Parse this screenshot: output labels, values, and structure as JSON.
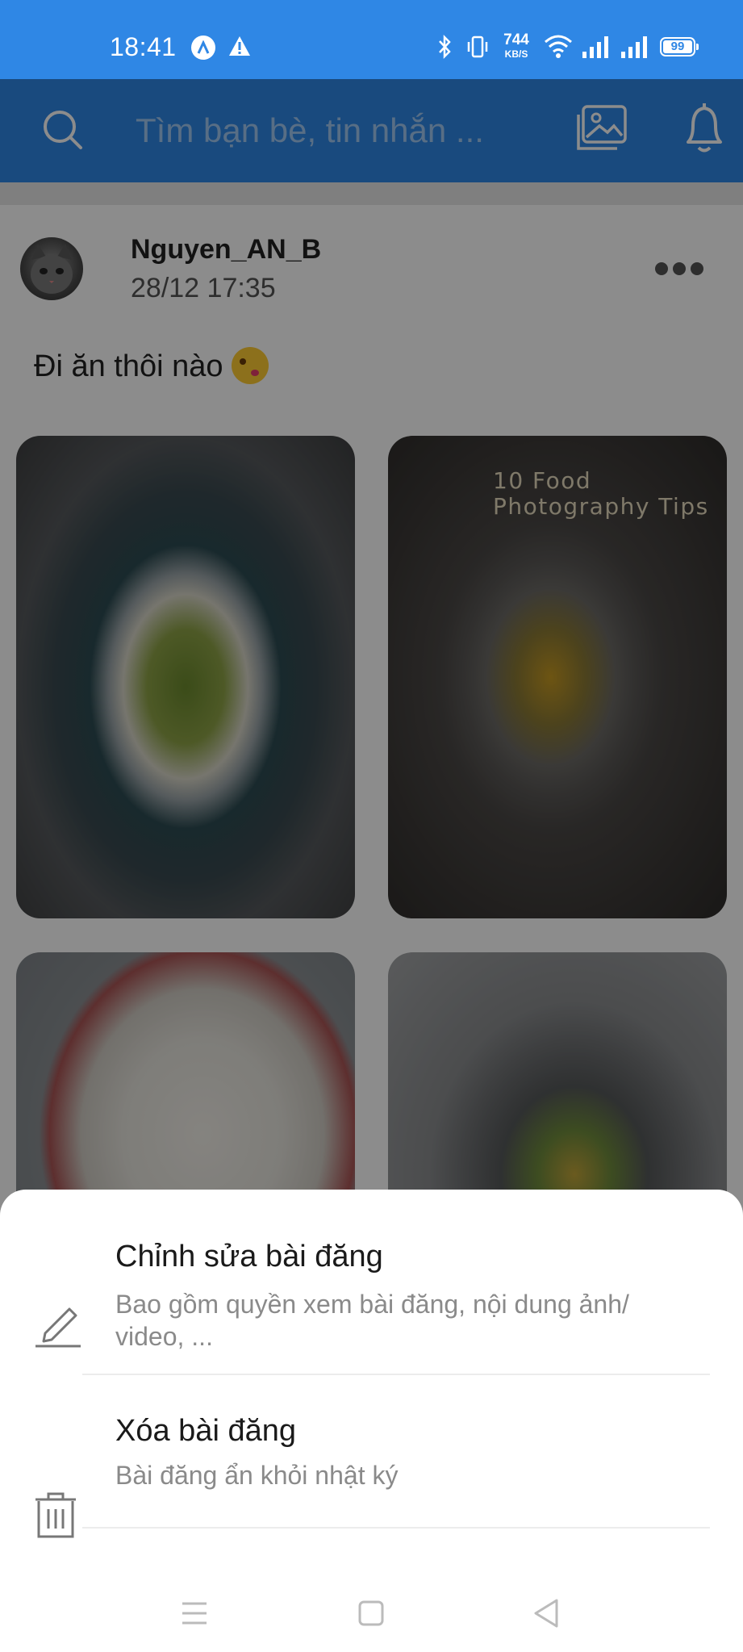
{
  "status_bar": {
    "time": "18:41",
    "net_speed_value": "744",
    "net_speed_unit": "KB/S",
    "battery": "99",
    "icons": [
      "app-badge-icon",
      "warning-icon",
      "bluetooth-icon",
      "vibrate-icon",
      "wifi-icon",
      "signal-icon",
      "signal-icon",
      "battery-icon"
    ]
  },
  "header": {
    "search_placeholder": "Tìm bạn bè, tin nhắn ...",
    "icons": [
      "search-icon",
      "gallery-icon",
      "bell-icon"
    ]
  },
  "post": {
    "author": "Nguyen_AN_B",
    "time": "28/12 17:35",
    "caption": "Đi ăn thôi nào",
    "caption_emoji": "kiss-emoji",
    "photo_overlay_text": "10 Food\nPhotography Tips",
    "photos": [
      "food-photo-1",
      "food-photo-2",
      "food-photo-3",
      "food-photo-4"
    ]
  },
  "sheet": {
    "edit": {
      "title": "Chỉnh sửa bài đăng",
      "desc": "Bao gồm quyền xem bài đăng, nội dung ảnh/ video, ..."
    },
    "delete": {
      "title": "Xóa bài đăng",
      "desc": "Bài đăng ẩn khỏi nhật ký"
    }
  },
  "nav": {
    "buttons": [
      "menu",
      "home",
      "back"
    ]
  },
  "colors": {
    "accent": "#2f87e5",
    "sheet_bg": "#ffffff",
    "text_primary": "#1a1a1a",
    "text_secondary": "#8a8a8a"
  }
}
